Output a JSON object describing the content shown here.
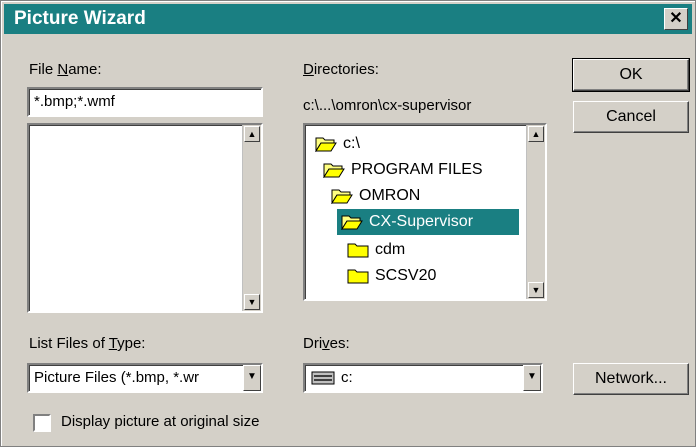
{
  "window": {
    "title": "Picture Wizard"
  },
  "file_name": {
    "label_pre": "File ",
    "label_key": "N",
    "label_post": "ame:",
    "value": "*.bmp;*.wmf"
  },
  "directories": {
    "label_key": "D",
    "label_post": "irectories:",
    "path": "c:\\...\\omron\\cx-supervisor",
    "items": [
      {
        "name": "c:\\",
        "icon": "open-folder-icon"
      },
      {
        "name": "PROGRAM FILES",
        "icon": "open-folder-icon"
      },
      {
        "name": "OMRON",
        "icon": "open-folder-icon"
      },
      {
        "name": "CX-Supervisor",
        "icon": "open-folder-icon",
        "selected": true
      },
      {
        "name": "cdm",
        "icon": "closed-folder-icon"
      },
      {
        "name": "SCSV20",
        "icon": "closed-folder-icon"
      }
    ]
  },
  "file_type": {
    "label_pre": "List Files of ",
    "label_key": "T",
    "label_post": "ype:",
    "value": "Picture Files (*.bmp, *.wr"
  },
  "drives": {
    "label_pre": "Dri",
    "label_key": "v",
    "label_post": "es:",
    "value": "c:"
  },
  "buttons": {
    "ok": "OK",
    "cancel": "Cancel",
    "network": "Network..."
  },
  "checkbox": {
    "label": "Display picture at original size",
    "checked": false
  },
  "colors": {
    "title_bar": "#1a7f82",
    "selection": "#1a7f82",
    "face": "#d4d0c8"
  }
}
